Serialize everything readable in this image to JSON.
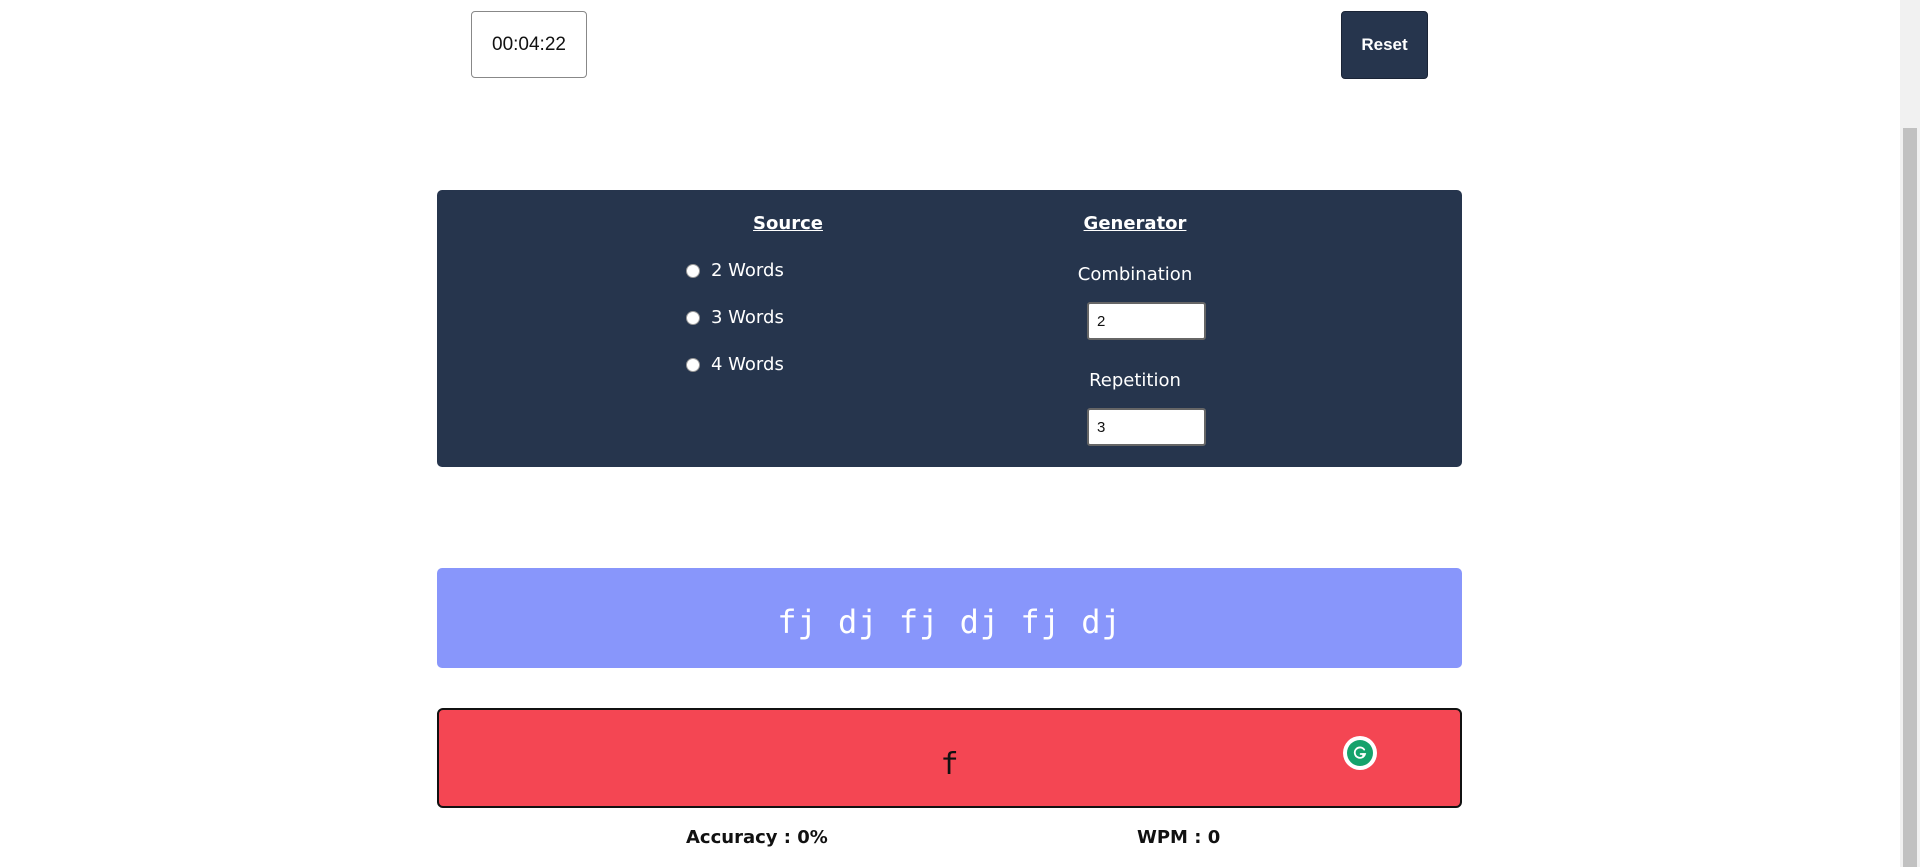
{
  "timer": {
    "value": "00:04:22"
  },
  "reset": {
    "label": "Reset"
  },
  "source": {
    "heading": "Source",
    "options": [
      {
        "label": "2 Words",
        "selected": false
      },
      {
        "label": "3 Words",
        "selected": false
      },
      {
        "label": "4 Words",
        "selected": false
      }
    ]
  },
  "generator": {
    "heading": "Generator",
    "combination_label": "Combination",
    "combination_value": "2",
    "repetition_label": "Repetition",
    "repetition_value": "3"
  },
  "practice": {
    "target_text": "fj dj fj dj fj dj",
    "typed_text": "f"
  },
  "stats": {
    "accuracy": "Accuracy : 0%",
    "wpm": "WPM : 0"
  },
  "icons": {
    "grammarly": "grammarly-icon"
  },
  "colors": {
    "panel": "#26354d",
    "target_bg": "#8896fb",
    "typing_bg": "#f44653",
    "grammarly": "#15a26b"
  }
}
